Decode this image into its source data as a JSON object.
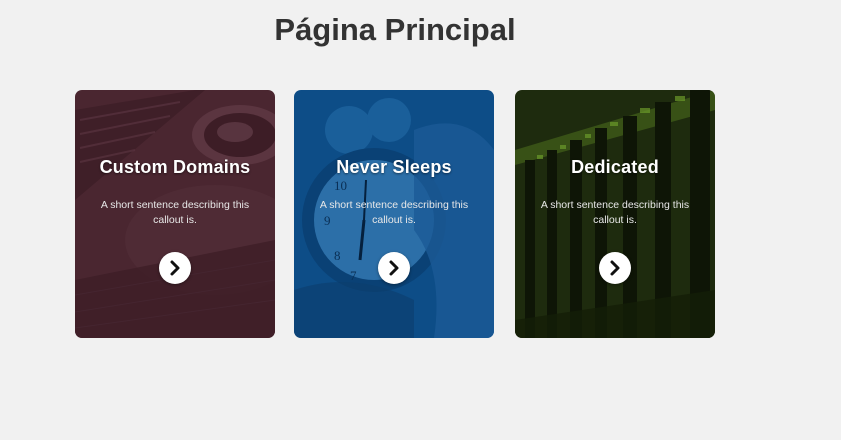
{
  "page": {
    "title": "Página Principal"
  },
  "cards": [
    {
      "title": "Custom Domains",
      "description": "A short sentence describing this callout is.",
      "icon": "chevron-right-icon",
      "color": "#4a2630"
    },
    {
      "title": "Never Sleeps",
      "description": "A short sentence describing this callout is.",
      "icon": "chevron-right-icon",
      "color": "#0d4d87"
    },
    {
      "title": "Dedicated",
      "description": "A short sentence describing this callout is.",
      "icon": "chevron-right-icon",
      "color": "#1e2b0e"
    }
  ]
}
